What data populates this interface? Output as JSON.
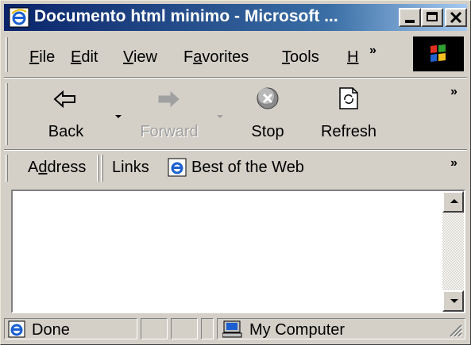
{
  "window": {
    "title": "Documento html minimo - Microsoft ..."
  },
  "menu": {
    "items": [
      {
        "label": "File",
        "accel": "F",
        "rest": "ile"
      },
      {
        "label": "Edit",
        "accel": "E",
        "rest": "dit"
      },
      {
        "label": "View",
        "accel": "V",
        "rest": "iew"
      },
      {
        "label": "Favorites",
        "pre": "F",
        "accel": "a",
        "rest": "vorites"
      },
      {
        "label": "Tools",
        "accel": "T",
        "rest": "ools"
      },
      {
        "label": "H",
        "accel": "H",
        "rest": ""
      }
    ],
    "overflow": "»"
  },
  "toolbar": {
    "back": "Back",
    "forward": "Forward",
    "stop": "Stop",
    "refresh": "Refresh",
    "overflow": "»"
  },
  "addressbar": {
    "address_label": "Address",
    "address_accel": "d",
    "links_label": "Links",
    "link_item": "Best of the Web",
    "overflow": "»"
  },
  "status": {
    "text": "Done",
    "zone": "My Computer"
  },
  "colors": {
    "titlebar_start": "#0a246a",
    "titlebar_end": "#a6caf0",
    "face": "#d4d0c8"
  }
}
